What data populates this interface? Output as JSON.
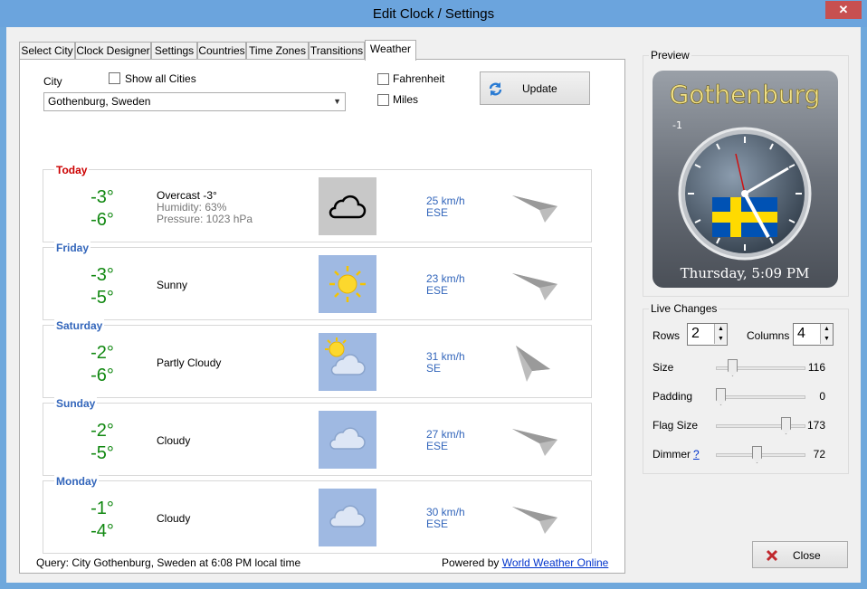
{
  "window": {
    "title": "Edit Clock / Settings",
    "close_glyph": "✕"
  },
  "tabs": [
    "Select City",
    "Clock Designer",
    "Settings",
    "Countries",
    "Time Zones",
    "Transitions",
    "Weather"
  ],
  "active_tab": "Weather",
  "weather": {
    "city_label": "City",
    "city_value": "Gothenburg, Sweden",
    "show_all_cities": "Show all Cities",
    "fahrenheit": "Fahrenheit",
    "miles": "Miles",
    "update_label": "Update",
    "days": [
      {
        "name": "Today",
        "high": "-3°",
        "low": "-6°",
        "condition": "Overcast -3°",
        "humidity": "Humidity: 63%",
        "pressure": "Pressure: 1023 hPa",
        "icon": "cloud-outline-icon",
        "wind_speed": "25 km/h",
        "wind_dir": "ESE"
      },
      {
        "name": "Friday",
        "high": "-3°",
        "low": "-5°",
        "condition": "Sunny",
        "icon": "sun-icon",
        "wind_speed": "23 km/h",
        "wind_dir": "ESE"
      },
      {
        "name": "Saturday",
        "high": "-2°",
        "low": "-6°",
        "condition": "Partly Cloudy",
        "icon": "partly-cloudy-icon",
        "wind_speed": "31 km/h",
        "wind_dir": "SE"
      },
      {
        "name": "Sunday",
        "high": "-2°",
        "low": "-5°",
        "condition": "Cloudy",
        "icon": "cloud-icon",
        "wind_speed": "27 km/h",
        "wind_dir": "ESE"
      },
      {
        "name": "Monday",
        "high": "-1°",
        "low": "-4°",
        "condition": "Cloudy",
        "icon": "cloud-icon",
        "wind_speed": "30 km/h",
        "wind_dir": "ESE"
      }
    ],
    "query_text": "Query: City Gothenburg, Sweden at 6:08 PM local time",
    "powered_by": "Powered by",
    "powered_link": "World Weather Online"
  },
  "preview": {
    "group_title": "Preview",
    "city_name": "Gothenburg",
    "offset": "-1",
    "date_time": "Thursday, 5:09 PM"
  },
  "live_changes": {
    "group_title": "Live Changes",
    "rows_label": "Rows",
    "rows_value": "2",
    "columns_label": "Columns",
    "columns_value": "4",
    "sliders": [
      {
        "label": "Size",
        "value": "116",
        "level": 0.15
      },
      {
        "label": "Padding",
        "value": "0",
        "level": 0.0
      },
      {
        "label": "Flag Size",
        "value": "173",
        "level": 0.82
      },
      {
        "label": "Dimmer",
        "value": "72",
        "level": 0.45
      }
    ],
    "dimmer_help": "?"
  },
  "close_label": "Close",
  "colors": {
    "title_bar": "#6ba4dd",
    "temp_green": "#118811",
    "day_blue": "#3366bb",
    "today_red": "#cc0000",
    "sweden_blue": "#0052b4",
    "sweden_yellow": "#ffda00"
  }
}
